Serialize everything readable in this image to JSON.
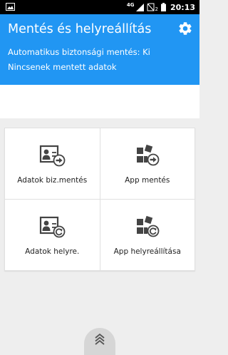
{
  "status_bar": {
    "network": "4G",
    "sim": "2",
    "time": "20:13",
    "icons": [
      "image-icon",
      "signal-icon",
      "no-sim-icon",
      "battery-icon"
    ]
  },
  "header": {
    "title": "Mentés és helyreállítás",
    "auto_backup_text": "Automatikus biztonsági mentés: Ki",
    "no_backup_text": "Nincsenek mentett adatok",
    "settings_icon": "gear-icon",
    "background_color": "#2196f3"
  },
  "tiles": [
    {
      "label": "Adatok biz.mentés",
      "icon": "contact-backup-icon"
    },
    {
      "label": "App mentés",
      "icon": "app-backup-icon"
    },
    {
      "label": "Adatok helyre.",
      "icon": "contact-restore-icon"
    },
    {
      "label": "App helyreállítása",
      "icon": "app-restore-icon"
    }
  ],
  "bottom": {
    "icon": "chevron-up-double-icon"
  }
}
